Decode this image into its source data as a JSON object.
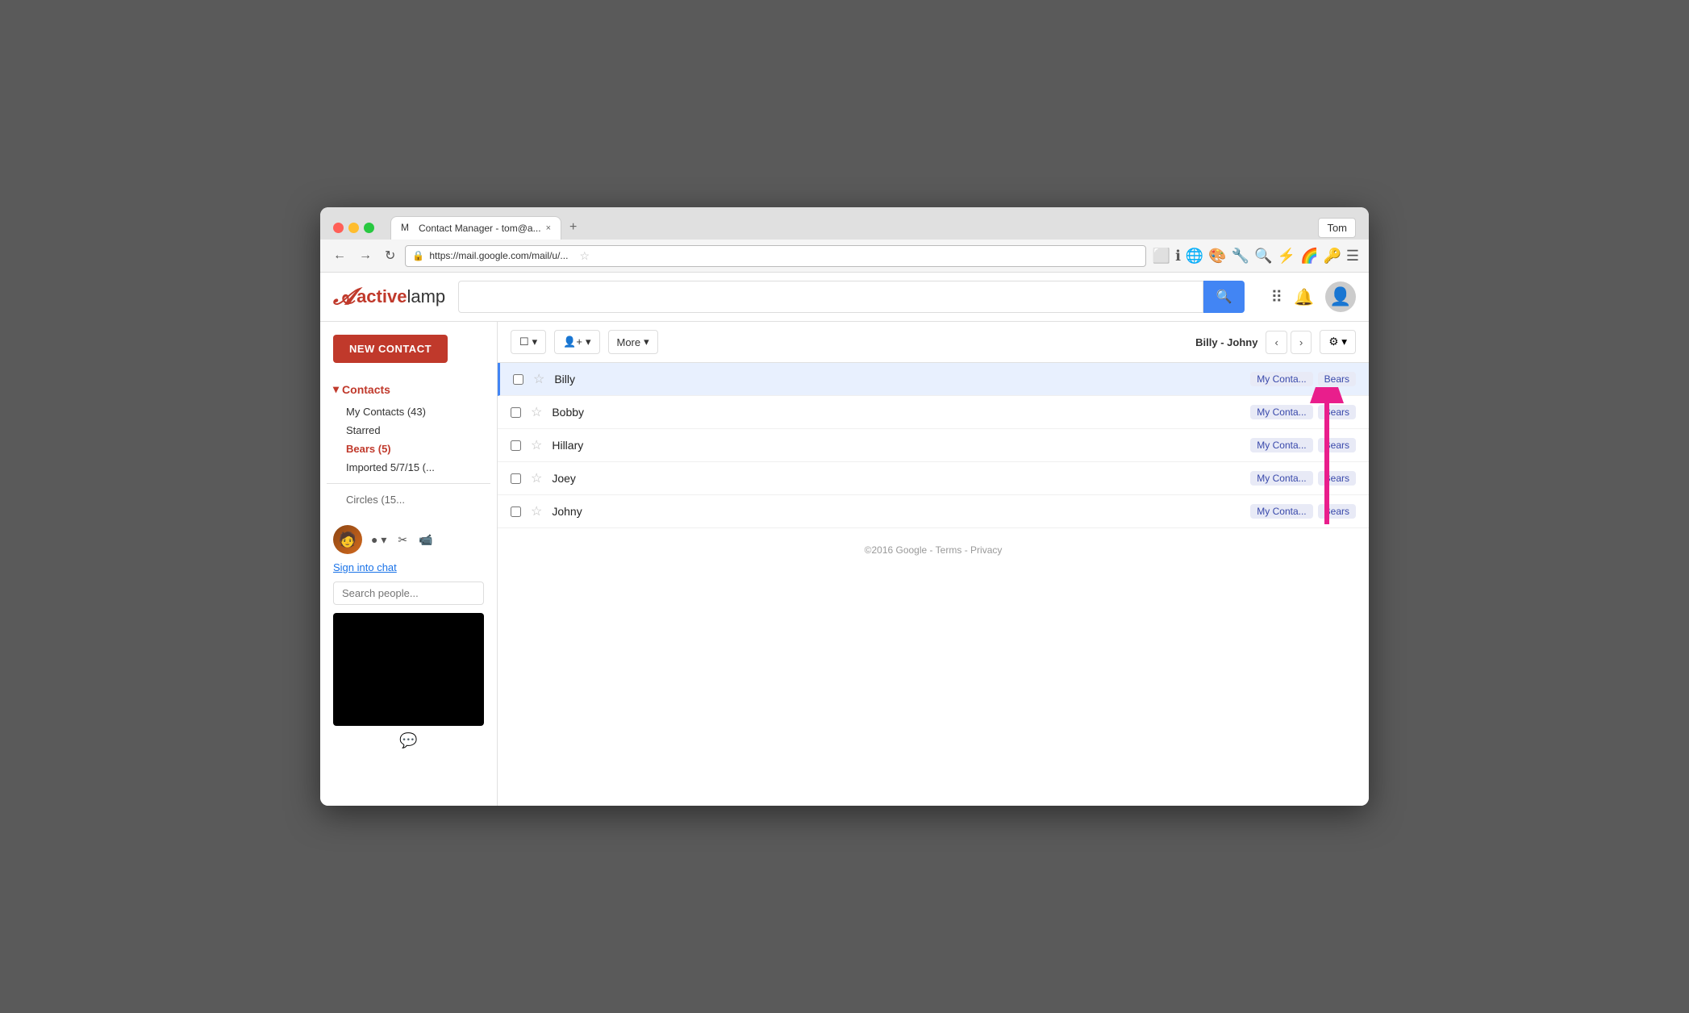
{
  "browser": {
    "tab_title": "Contact Manager - tom@a...",
    "url": "https://mail.google.com/mail/u/...",
    "tom_label": "Tom",
    "tab_close": "×"
  },
  "header": {
    "logo_active": "active",
    "logo_lamp": "lamp",
    "search_placeholder": "",
    "search_btn_icon": "🔍"
  },
  "sidebar": {
    "new_contact_label": "NEW CONTACT",
    "contacts_label": "Contacts",
    "my_contacts": "My Contacts (43)",
    "starred": "Starred",
    "bears": "Bears (5)",
    "imported": "Imported 5/7/15 (...",
    "circles": "Circles (15...",
    "sign_into_chat": "Sign into chat",
    "search_people_placeholder": "Search people..."
  },
  "toolbar": {
    "select_label": "☐",
    "add_person_label": "👤+",
    "more_label": "More",
    "contact_range": "Billy - Johny",
    "settings_icon": "⚙"
  },
  "contacts": [
    {
      "name": "Billy",
      "tag1": "My Conta...",
      "tag2": "Bears",
      "starred": false,
      "active": true
    },
    {
      "name": "Bobby",
      "tag1": "My Conta...",
      "tag2": "Bears",
      "starred": false,
      "active": false
    },
    {
      "name": "Hillary",
      "tag1": "My Conta...",
      "tag2": "Bears",
      "starred": false,
      "active": false
    },
    {
      "name": "Joey",
      "tag1": "My Conta...",
      "tag2": "Bears",
      "starred": false,
      "active": false
    },
    {
      "name": "Johny",
      "tag1": "My Conta...",
      "tag2": "Bears",
      "starred": false,
      "active": false
    }
  ],
  "footer": {
    "copyright": "©2016 Google",
    "dash1": "-",
    "terms": "Terms",
    "dash2": "-",
    "privacy": "Privacy"
  },
  "colors": {
    "accent_red": "#c0392b",
    "link_blue": "#1a73e8",
    "tag_blue": "#3949ab",
    "tag_bg": "#e8eaf6",
    "active_row_bg": "#e8f0fe"
  }
}
